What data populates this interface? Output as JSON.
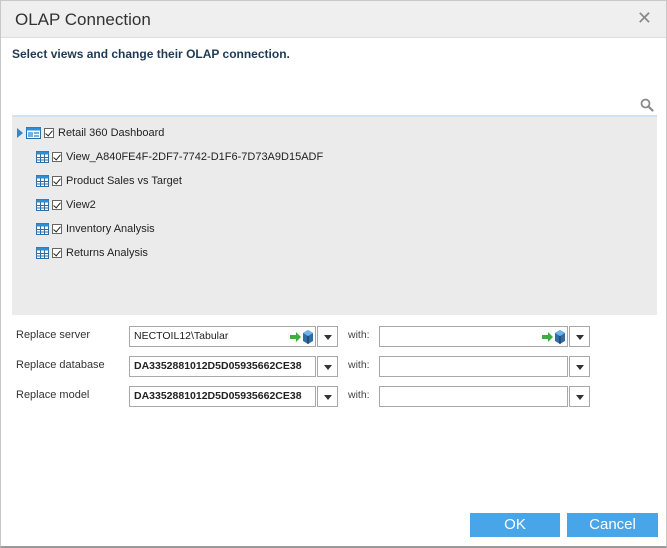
{
  "dialog": {
    "title": "OLAP Connection",
    "close_glyph": "✕",
    "instruction": "Select views and change their OLAP connection."
  },
  "tree": {
    "root": {
      "label": "Retail 360 Dashboard",
      "checked": true,
      "icon": "dashboard-icon"
    },
    "children": [
      {
        "label": "View_A840FE4F-2DF7-7742-D1F6-7D73A9D15ADF",
        "checked": true,
        "icon": "table-icon"
      },
      {
        "label": "Product Sales vs Target",
        "checked": true,
        "icon": "table-icon"
      },
      {
        "label": "View2",
        "checked": true,
        "icon": "table-icon"
      },
      {
        "label": "Inventory Analysis",
        "checked": true,
        "icon": "table-icon"
      },
      {
        "label": "Returns Analysis",
        "checked": true,
        "icon": "table-icon"
      }
    ]
  },
  "form": {
    "with_label": "with:",
    "server": {
      "label": "Replace server",
      "value": "NECTOIL12\\Tabular",
      "with_value": ""
    },
    "database": {
      "label": "Replace database",
      "value": "DA3352881012D5D05935662CE38",
      "with_value": ""
    },
    "model": {
      "label": "Replace model",
      "value": "DA3352881012D5D05935662CE38",
      "with_value": ""
    }
  },
  "buttons": {
    "ok": "OK",
    "cancel": "Cancel"
  },
  "colors": {
    "accent": "#48a6e8",
    "tree_background": "#ebebeb",
    "title_bar": "#efefef"
  }
}
